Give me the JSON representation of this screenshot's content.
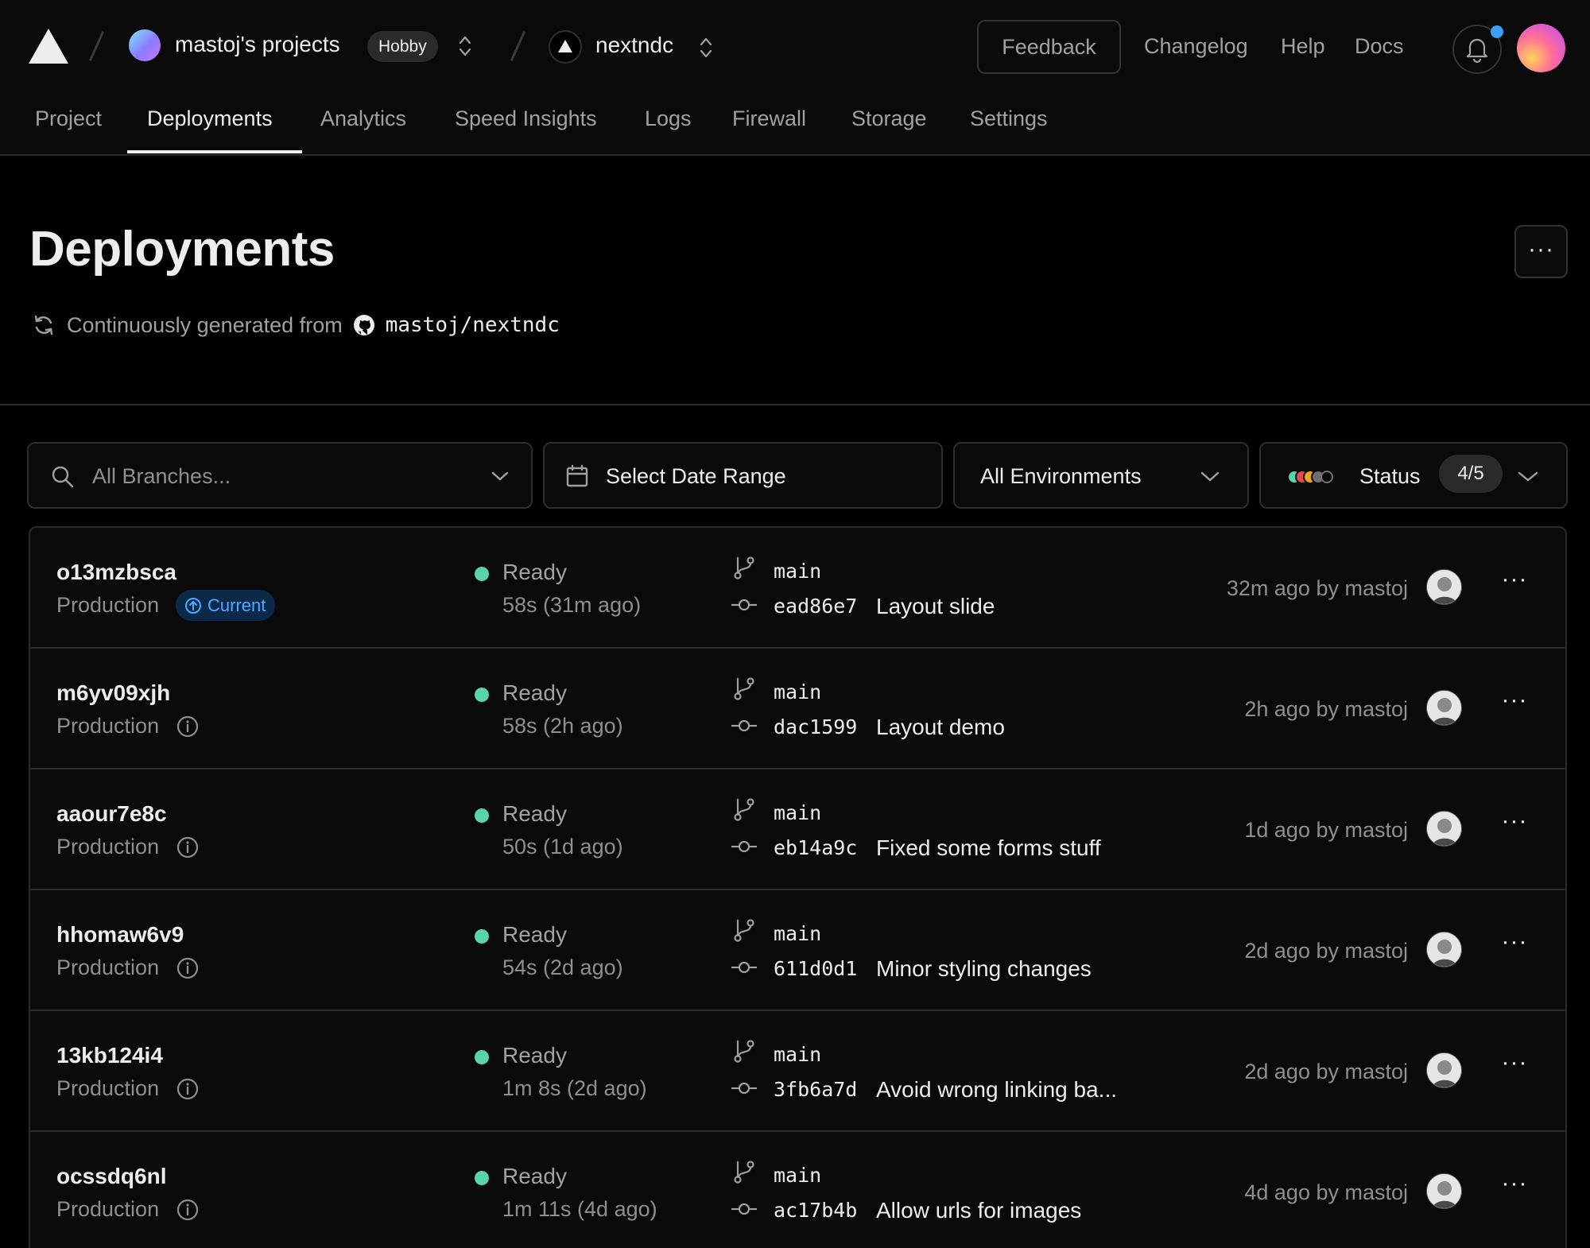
{
  "header": {
    "project_name": "mastoj's projects",
    "plan_badge": "Hobby",
    "repo_name": "nextndc",
    "feedback_label": "Feedback",
    "links": [
      "Changelog",
      "Help",
      "Docs"
    ]
  },
  "tabs": [
    "Project",
    "Deployments",
    "Analytics",
    "Speed Insights",
    "Logs",
    "Firewall",
    "Storage",
    "Settings"
  ],
  "active_tab": "Deployments",
  "page": {
    "title": "Deployments",
    "subtitle": "Continuously generated from",
    "repo": "mastoj/nextndc",
    "more_label": "···"
  },
  "filters": {
    "branches_placeholder": "All Branches...",
    "date_range_label": "Select Date Range",
    "environments_label": "All Environments",
    "status_label": "Status",
    "status_count": "4/5"
  },
  "colors": {
    "ready": "#58d4ad",
    "accent_blue": "#52a8ff",
    "status_palette": [
      "#58d4ad",
      "#e5484d",
      "#f5a524",
      "#6e6e6e",
      "#0a0a0a"
    ]
  },
  "deployments": [
    {
      "id": "o13mzbsca",
      "environment": "Production",
      "badge": "Current",
      "status": "Ready",
      "duration": "58s (31m ago)",
      "branch": "main",
      "sha": "ead86e7",
      "message": "Layout slide",
      "age": "32m ago by mastoj"
    },
    {
      "id": "m6yv09xjh",
      "environment": "Production",
      "status": "Ready",
      "duration": "58s (2h ago)",
      "branch": "main",
      "sha": "dac1599",
      "message": "Layout demo",
      "age": "2h ago by mastoj"
    },
    {
      "id": "aaour7e8c",
      "environment": "Production",
      "status": "Ready",
      "duration": "50s (1d ago)",
      "branch": "main",
      "sha": "eb14a9c",
      "message": "Fixed some forms stuff",
      "age": "1d ago by mastoj"
    },
    {
      "id": "hhomaw6v9",
      "environment": "Production",
      "status": "Ready",
      "duration": "54s (2d ago)",
      "branch": "main",
      "sha": "611d0d1",
      "message": "Minor styling changes",
      "age": "2d ago by mastoj"
    },
    {
      "id": "13kb124i4",
      "environment": "Production",
      "status": "Ready",
      "duration": "1m 8s (2d ago)",
      "branch": "main",
      "sha": "3fb6a7d",
      "message": "Avoid wrong linking ba...",
      "age": "2d ago by mastoj"
    },
    {
      "id": "ocssdq6nl",
      "environment": "Production",
      "status": "Ready",
      "duration": "1m 11s (4d ago)",
      "branch": "main",
      "sha": "ac17b4b",
      "message": "Allow urls for images",
      "age": "4d ago by mastoj"
    }
  ]
}
